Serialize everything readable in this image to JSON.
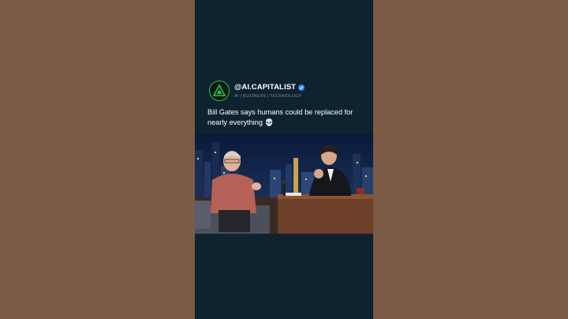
{
  "post": {
    "handle": "@AI.CAPITALIST",
    "tagline": "AI | BUSINESS | TECHNOLOGY",
    "caption": "Bill Gates says humans could be replaced for nearly everything",
    "caption_emoji": "💀"
  },
  "icons": [
    "ai-capitalist-logo-icon",
    "verified-badge-icon",
    "skull-icon"
  ],
  "colors": {
    "background": "#7b5a46",
    "panel": "#0f2230",
    "accent_green": "#2fbf4f",
    "verified_blue": "#2d8cf0"
  }
}
